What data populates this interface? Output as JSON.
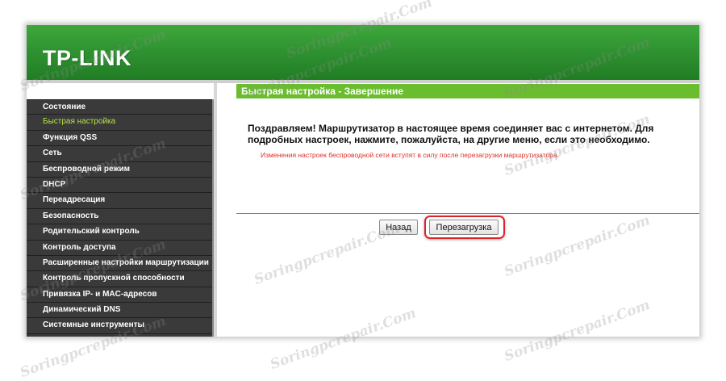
{
  "header": {
    "logo_text": "TP-LINK"
  },
  "sidebar": {
    "items": [
      {
        "label": "Состояние",
        "active": false
      },
      {
        "label": "Быстрая настройка",
        "active": true
      },
      {
        "label": "Функция QSS",
        "active": false
      },
      {
        "label": "Сеть",
        "active": false
      },
      {
        "label": "Беспроводной режим",
        "active": false
      },
      {
        "label": "DHCP",
        "active": false
      },
      {
        "label": "Переадресация",
        "active": false
      },
      {
        "label": "Безопасность",
        "active": false
      },
      {
        "label": "Родительский контроль",
        "active": false
      },
      {
        "label": "Контроль доступа",
        "active": false
      },
      {
        "label": "Расширенные настройки маршрутизации",
        "active": false
      },
      {
        "label": "Контроль пропускной способности",
        "active": false
      },
      {
        "label": "Привязка IP- и MAC-адресов",
        "active": false
      },
      {
        "label": "Динамический DNS",
        "active": false
      },
      {
        "label": "Системные инструменты",
        "active": false
      }
    ]
  },
  "main": {
    "title": "Быстрая настройка - Завершение",
    "message": "Поздравляем! Маршрутизатор в настоящее время соединяет вас с интернетом. Для подробных настроек, нажмите, пожалуйста, на другие меню, если это необходимо.",
    "note": "Изменения настроек беспроводной сети вступят в силу после перезагрузки маршрутизатора.",
    "back_label": "Назад",
    "reboot_label": "Перезагрузка"
  },
  "watermark": {
    "text": "Soringpcrepair.Com"
  },
  "colors": {
    "header_green": "#2f9231",
    "title_green": "#6abd2f",
    "sidebar_bg": "#3a3a3a",
    "active_item": "#b6e04a",
    "note_red": "#e0302a",
    "highlight_red": "#d9262b"
  }
}
